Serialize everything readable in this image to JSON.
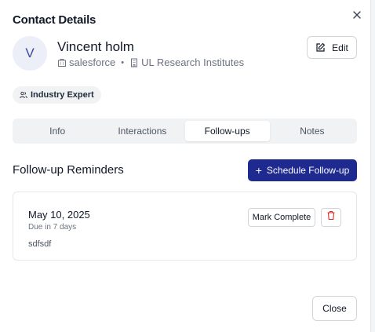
{
  "dialog": {
    "title": "Contact Details",
    "close_icon": "close-icon"
  },
  "contact": {
    "avatar_initial": "V",
    "name": "Vincent holm",
    "company": "salesforce",
    "company_icon": "building-icon",
    "separator": "•",
    "organization": "UL Research Institutes",
    "organization_icon": "office-icon",
    "edit_label": "Edit",
    "edit_icon": "pencil-square-icon"
  },
  "tag": {
    "label": "Industry Expert",
    "icon": "users-icon"
  },
  "tabs": [
    {
      "label": "Info",
      "active": false
    },
    {
      "label": "Interactions",
      "active": false
    },
    {
      "label": "Follow-ups",
      "active": true
    },
    {
      "label": "Notes",
      "active": false
    }
  ],
  "followups": {
    "heading": "Follow-up Reminders",
    "schedule_label": "Schedule Follow-up",
    "schedule_icon": "plus-icon",
    "items": [
      {
        "date": "May 10, 2025",
        "due": "Due in 7 days",
        "note": "sdfsdf",
        "mark_label": "Mark Complete",
        "delete_icon": "trash-icon"
      }
    ]
  },
  "footer": {
    "close_label": "Close"
  },
  "colors": {
    "primary": "#1e2a8f",
    "danger": "#dc2626",
    "tab_track": "#f1f2f4",
    "avatar_bg": "#eceef8"
  }
}
